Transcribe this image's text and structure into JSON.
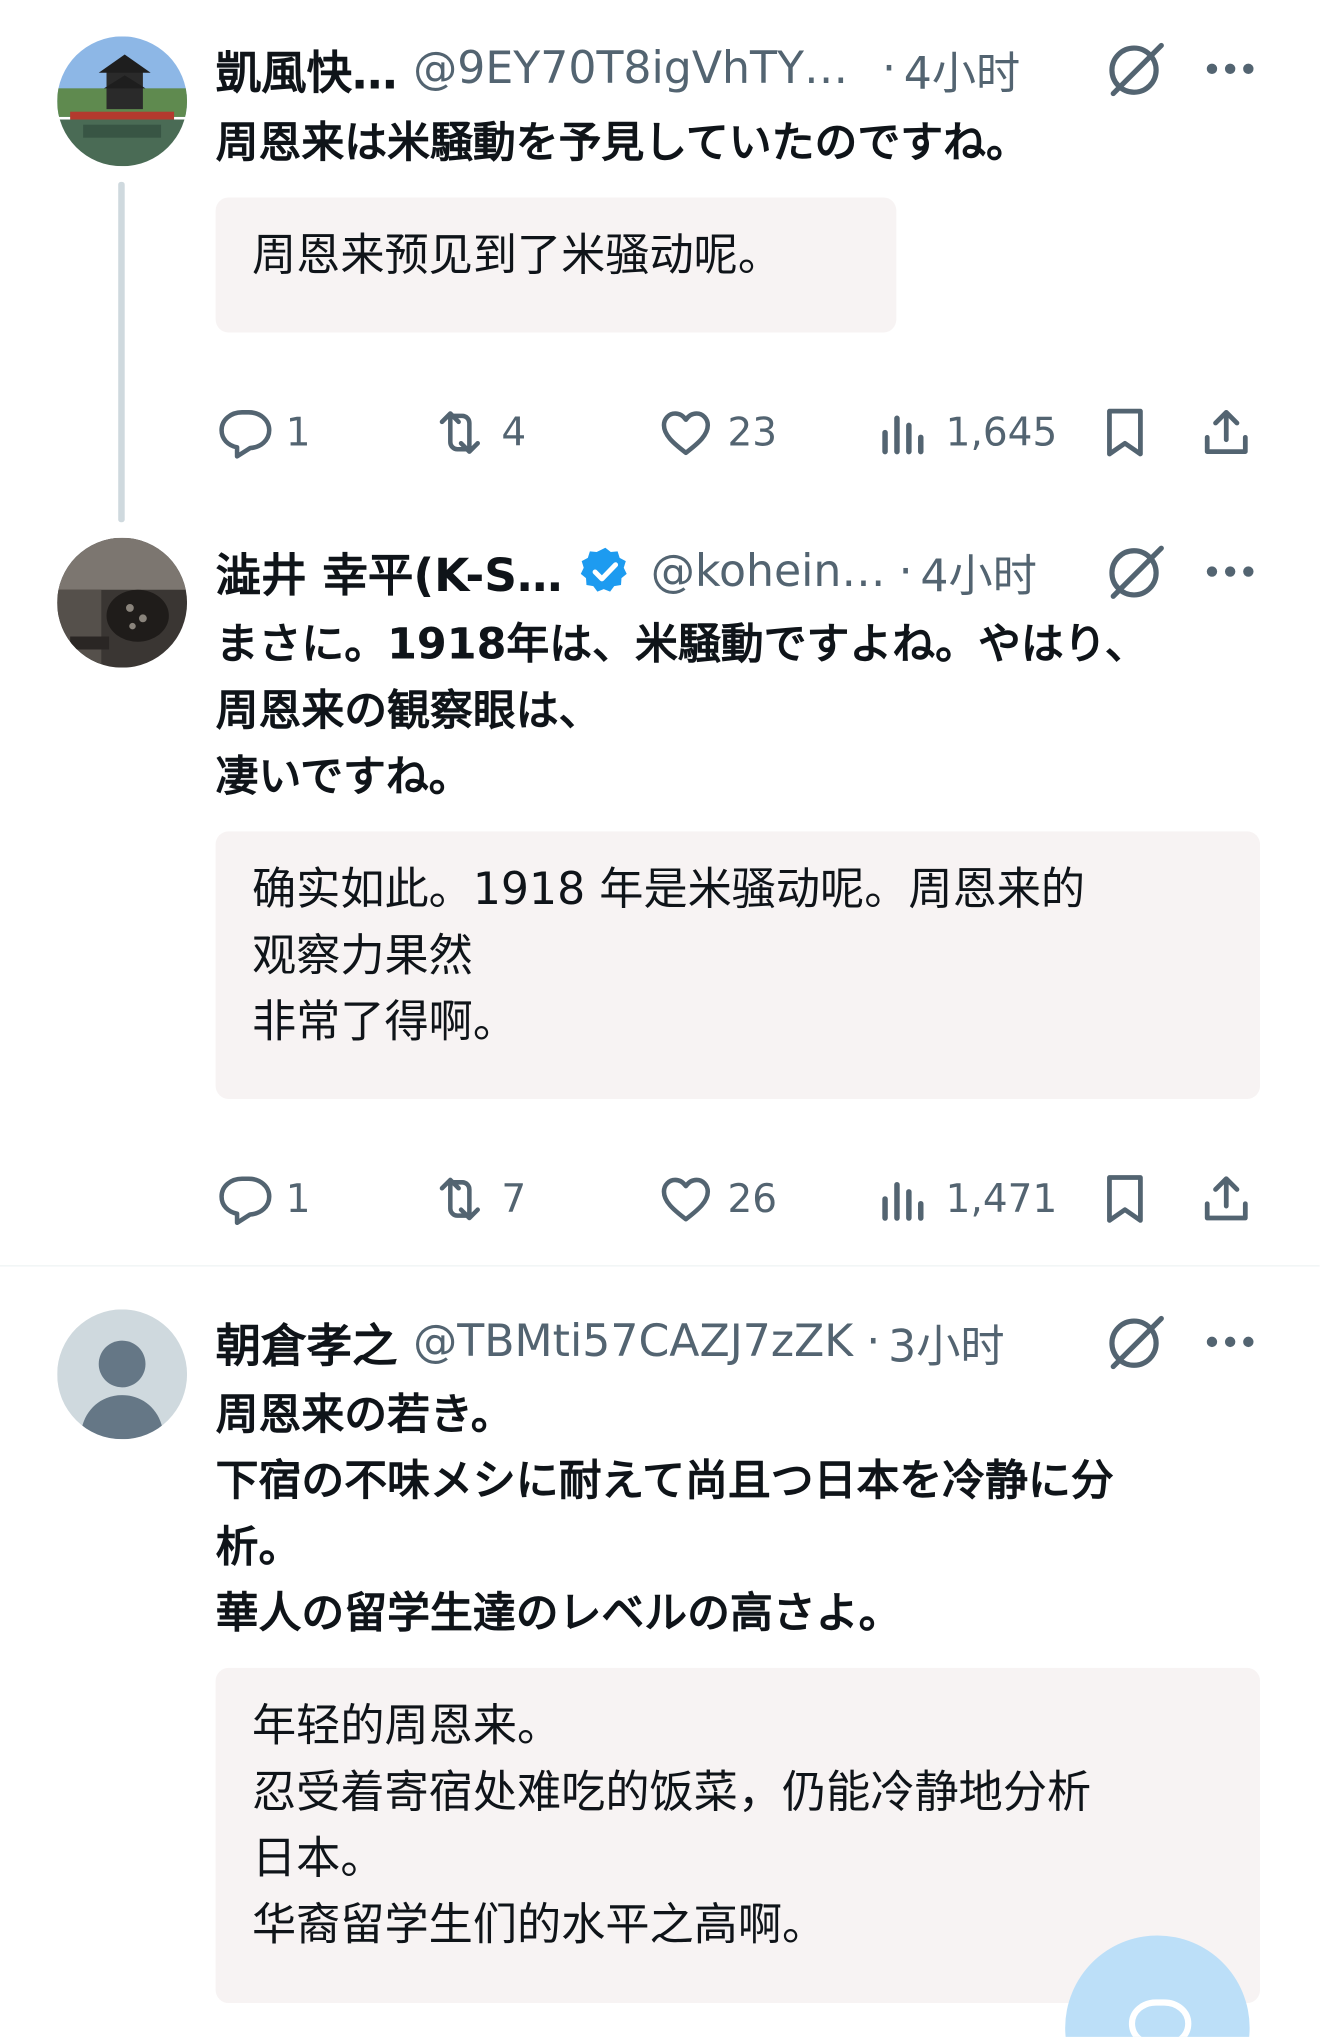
{
  "posts": [
    {
      "display_name": "凱風快…",
      "handle": "@9EY70T8igVhTY…",
      "verified": false,
      "separator": "·",
      "time": "4小时",
      "text_lines": [
        "周恩来は米騒動を予見していたのですね。"
      ],
      "translation_lines": [
        "周恩来预见到了米骚动呢。"
      ],
      "stats": {
        "replies": "1",
        "reposts": "4",
        "likes": "23",
        "views": "1,645"
      }
    },
    {
      "display_name": "澁井 幸平(K-S…",
      "handle": "@kohein…",
      "verified": true,
      "separator": "·",
      "time": "4小时",
      "text_lines": [
        "まさに。1918年は、米騒動ですよね。やはり、",
        "周恩来の観察眼は、",
        "凄いですね。"
      ],
      "translation_lines": [
        "确实如此。1918 年是米骚动呢。周恩来的",
        "观察力果然",
        "非常了得啊。"
      ],
      "stats": {
        "replies": "1",
        "reposts": "7",
        "likes": "26",
        "views": "1,471"
      }
    },
    {
      "display_name": "朝倉孝之",
      "handle": "@TBMti57CAZJ7zZK",
      "verified": false,
      "separator": "·",
      "time": "3小时",
      "text_lines": [
        "周恩来の若き。",
        "下宿の不味メシに耐えて尚且つ日本を冷静に分",
        "析。",
        "華人の留学生達のレベルの高さよ。"
      ],
      "translation_lines": [
        "年轻的周恩来。",
        "忍受着寄宿处难吃的饭菜，仍能冷静地分析",
        "日本。",
        "华裔留学生们的水平之高啊。"
      ]
    }
  ],
  "icons": {
    "grok": "grok-icon",
    "more": "more-options-icon",
    "reply": "reply-icon",
    "repost": "repost-icon",
    "like": "like-icon",
    "views": "views-icon",
    "bookmark": "bookmark-icon",
    "share": "share-icon",
    "verified": "verified-badge-icon",
    "compose": "compose-reply-icon"
  },
  "colors": {
    "text": "#0f1419",
    "secondary": "#536471",
    "verified": "#1d9bf0",
    "translation_bg": "#f7f3f3",
    "fab": "#bcdff8"
  }
}
